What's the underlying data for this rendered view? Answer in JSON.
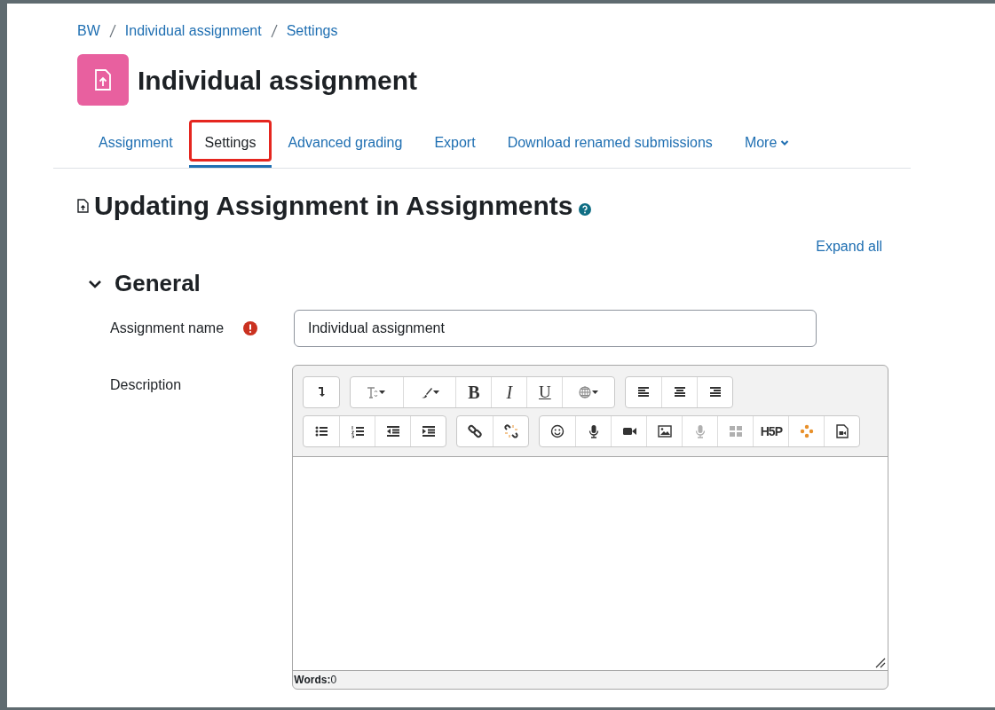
{
  "breadcrumb": [
    "BW",
    "Individual assignment",
    "Settings"
  ],
  "page_title": "Individual assignment",
  "tabs": [
    {
      "label": "Assignment",
      "selected": false,
      "annotated": false
    },
    {
      "label": "Settings",
      "selected": true,
      "annotated": true
    },
    {
      "label": "Advanced grading",
      "selected": false,
      "annotated": false
    },
    {
      "label": "Export",
      "selected": false,
      "annotated": false
    },
    {
      "label": "Download renamed submissions",
      "selected": false,
      "annotated": false
    },
    {
      "label": "More",
      "selected": false,
      "annotated": false,
      "kind": "menu"
    }
  ],
  "heading": "Updating Assignment in Assignments",
  "expand_all": "Expand all",
  "section": {
    "title": "General",
    "expanded": true
  },
  "fields": [
    {
      "label": "Assignment name",
      "required": true,
      "value": "Individual assignment"
    }
  ],
  "description": {
    "label": "Description",
    "toolbar_rows": [
      [
        [
          {
            "kind": "collapse",
            "disabled": false
          }
        ],
        [
          {
            "kind": "fontsize",
            "disabled": false
          },
          {
            "kind": "brush",
            "disabled": false
          },
          {
            "kind": "bold",
            "text": "B",
            "disabled": false
          },
          {
            "kind": "italic",
            "text": "I",
            "disabled": false
          },
          {
            "kind": "underline",
            "text": "U",
            "disabled": false
          },
          {
            "kind": "globe",
            "disabled": false
          }
        ],
        [
          {
            "kind": "align-left",
            "disabled": false
          },
          {
            "kind": "align-center",
            "disabled": false
          },
          {
            "kind": "align-right",
            "disabled": false
          }
        ]
      ],
      [
        [
          {
            "kind": "bullets",
            "disabled": false
          },
          {
            "kind": "numbers",
            "disabled": false
          },
          {
            "kind": "outdent",
            "disabled": false
          },
          {
            "kind": "indent",
            "disabled": false
          }
        ],
        [
          {
            "kind": "link",
            "disabled": false
          },
          {
            "kind": "unlink",
            "disabled": false
          }
        ],
        [
          {
            "kind": "emoji",
            "disabled": false
          },
          {
            "kind": "mic",
            "disabled": false
          },
          {
            "kind": "video",
            "disabled": false
          },
          {
            "kind": "image",
            "disabled": false
          },
          {
            "kind": "mic",
            "disabled": true
          },
          {
            "kind": "grid",
            "disabled": true
          },
          {
            "kind": "h5p",
            "text": "H5P",
            "disabled": false
          },
          {
            "kind": "dots",
            "disabled": false
          },
          {
            "kind": "media-file",
            "disabled": false
          }
        ]
      ]
    ],
    "word_count": "**Words:**0"
  }
}
